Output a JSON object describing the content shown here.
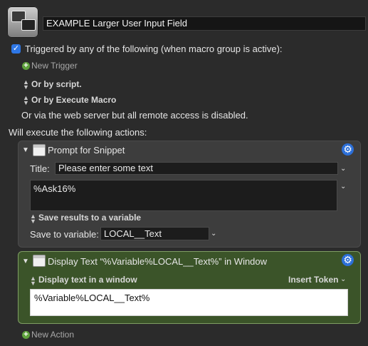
{
  "macro": {
    "name": "EXAMPLE Larger User Input Field"
  },
  "trigger": {
    "checkbox_checked": true,
    "label": "Triggered by any of the following (when macro group is active):",
    "new_trigger": "New Trigger",
    "or_by_script": "Or by script.",
    "or_by_execute_macro": "Or by Execute Macro",
    "web_server_note": "Or via the web server but all remote access is disabled."
  },
  "actions_header": "Will execute the following actions:",
  "action1": {
    "title": "Prompt for Snippet",
    "title_label": "Title:",
    "title_value": "Please enter some text",
    "text_value": "%Ask16%",
    "save_results": "Save results to a variable",
    "save_to_label": "Save to variable:",
    "save_to_value": "LOCAL__Text"
  },
  "action2": {
    "title": "Display Text “%Variable%LOCAL__Text%” in Window",
    "mode": "Display text in a window",
    "insert_token": "Insert Token",
    "text_value": "%Variable%LOCAL__Text%"
  },
  "new_action": "New Action",
  "colors": {
    "accent_blue": "#2c6fd8",
    "green_panel": "#3b5429",
    "add_green": "#5ea13c"
  },
  "icons": [
    "macro-icon",
    "checkbox-icon",
    "plus-circle-icon",
    "chevron-updown-icon",
    "disclosure-triangle-icon",
    "app-window-icon",
    "gear-icon",
    "chevron-down-icon"
  ]
}
